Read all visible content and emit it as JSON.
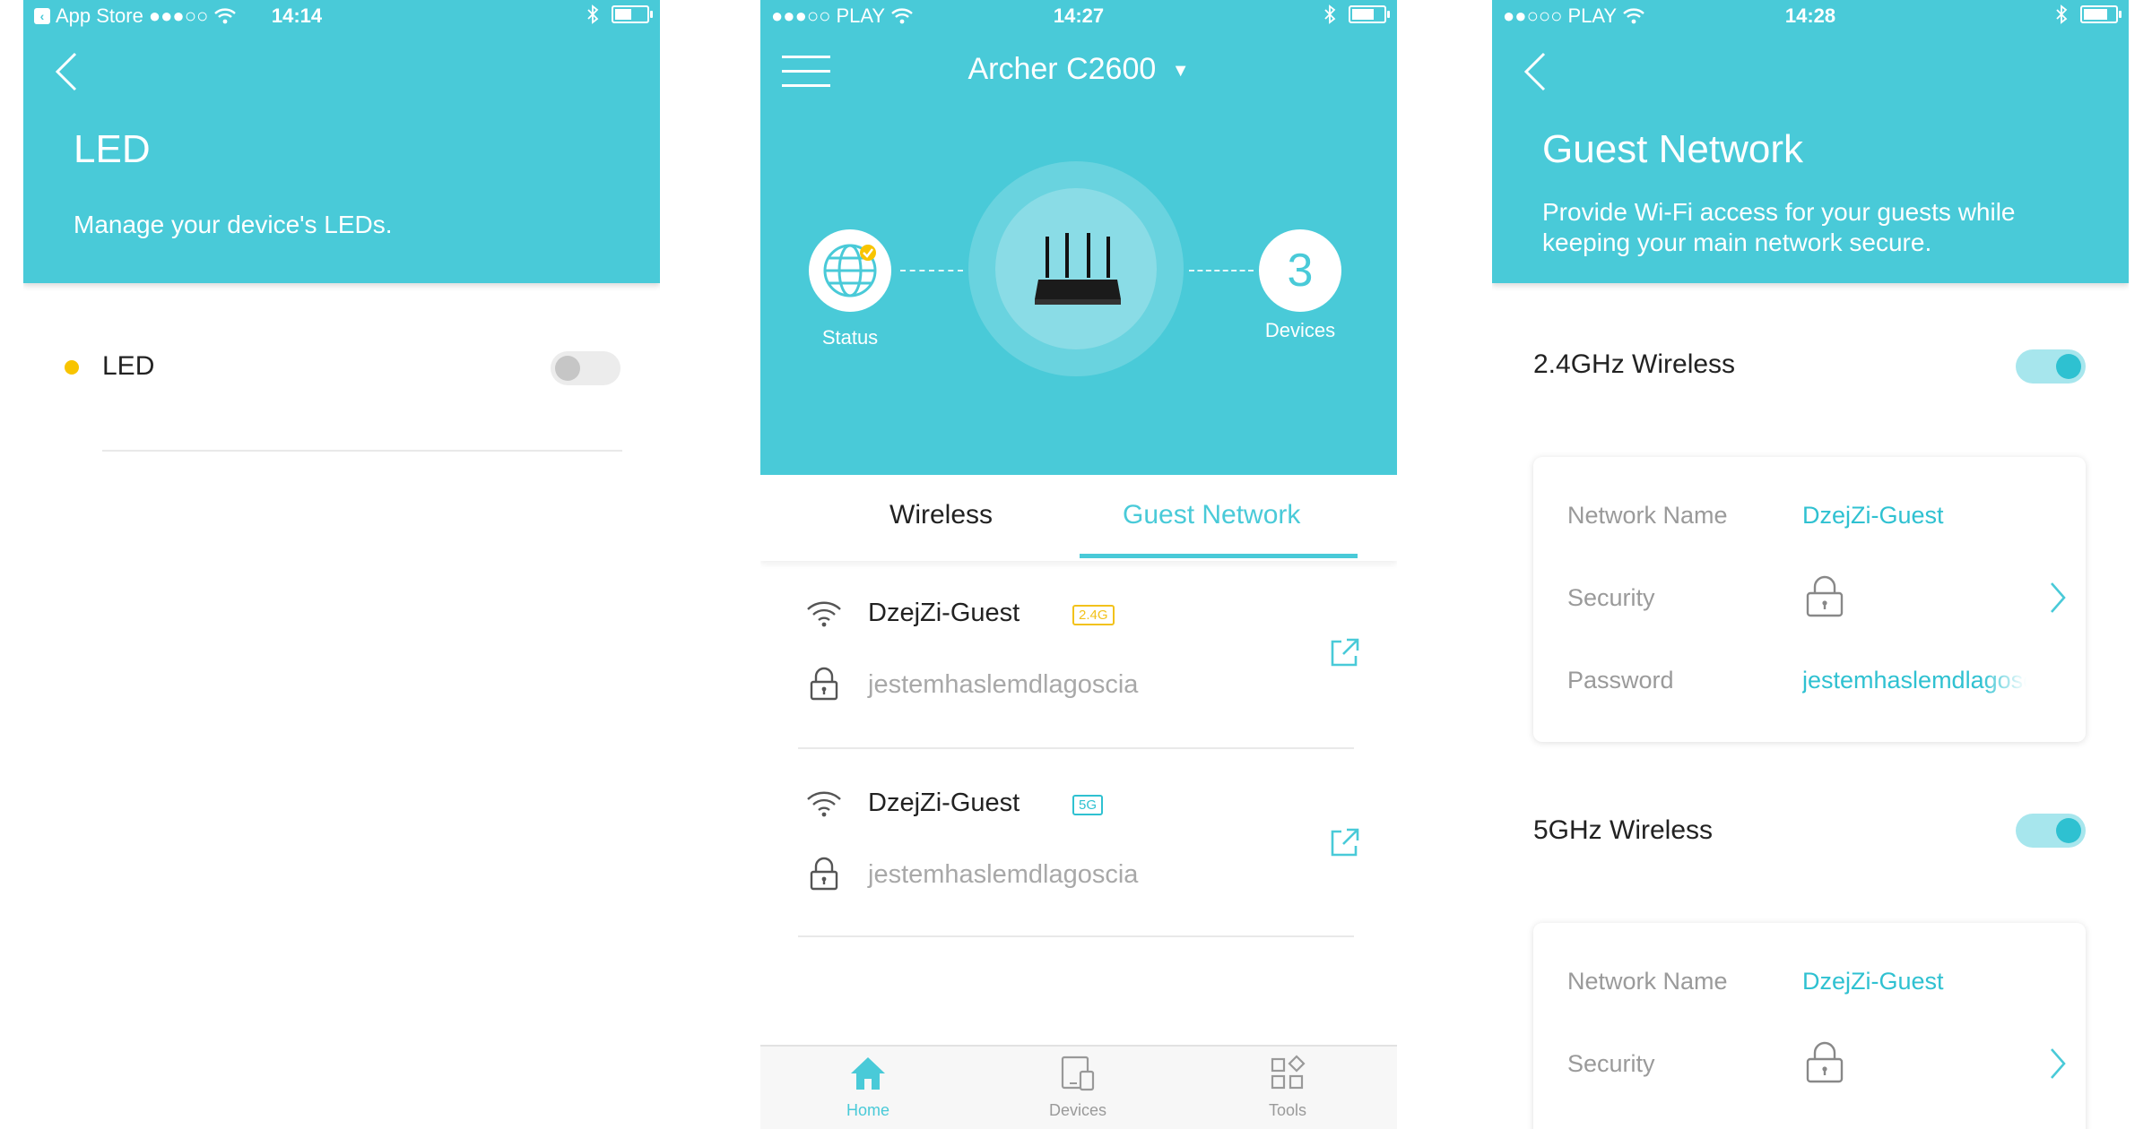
{
  "screen1": {
    "status_bar": {
      "carrier": "App Store",
      "signal": "●●●○○",
      "time": "14:14",
      "battery_level": 0.6
    },
    "title": "LED",
    "description": "Manage your device's LEDs.",
    "led_item": {
      "label": "LED",
      "enabled": false
    }
  },
  "screen2": {
    "status_bar": {
      "carrier": "PLAY",
      "signal": "●●●○○",
      "time": "14:27",
      "battery_level": 0.8
    },
    "router_name": "Archer C2600",
    "status_label": "Status",
    "devices_count": "3",
    "devices_label": "Devices",
    "tabs": [
      {
        "label": "Wireless",
        "active": false
      },
      {
        "label": "Guest Network",
        "active": true
      }
    ],
    "networks": [
      {
        "ssid": "DzejZi-Guest",
        "band": "2.4G",
        "band_color": "#f2c21b",
        "password": "jestemhaslemdlagoscia"
      },
      {
        "ssid": "DzejZi-Guest",
        "band": "5G",
        "band_color": "#2fc1d1",
        "password": "jestemhaslemdlagoscia"
      }
    ],
    "nav": [
      {
        "label": "Home",
        "icon": "home-icon",
        "active": true
      },
      {
        "label": "Devices",
        "icon": "devices-icon",
        "active": false
      },
      {
        "label": "Tools",
        "icon": "tools-icon",
        "active": false
      }
    ]
  },
  "screen3": {
    "status_bar": {
      "carrier": "PLAY",
      "signal": "●●○○○",
      "time": "14:28",
      "battery_level": 0.85
    },
    "title": "Guest Network",
    "description": "Provide Wi-Fi access for your guests while keeping your main network secure.",
    "bands": [
      {
        "label": "2.4GHz Wireless",
        "enabled": true,
        "fields": {
          "network_name_label": "Network Name",
          "network_name": "DzejZi-Guest",
          "security_label": "Security",
          "password_label": "Password",
          "password": "jestemhaslemdlagoscia"
        }
      },
      {
        "label": "5GHz Wireless",
        "enabled": true,
        "fields": {
          "network_name_label": "Network Name",
          "network_name": "DzejZi-Guest",
          "security_label": "Security"
        }
      }
    ]
  },
  "colors": {
    "accent": "#49cad8",
    "led_dot": "#f8c400"
  }
}
